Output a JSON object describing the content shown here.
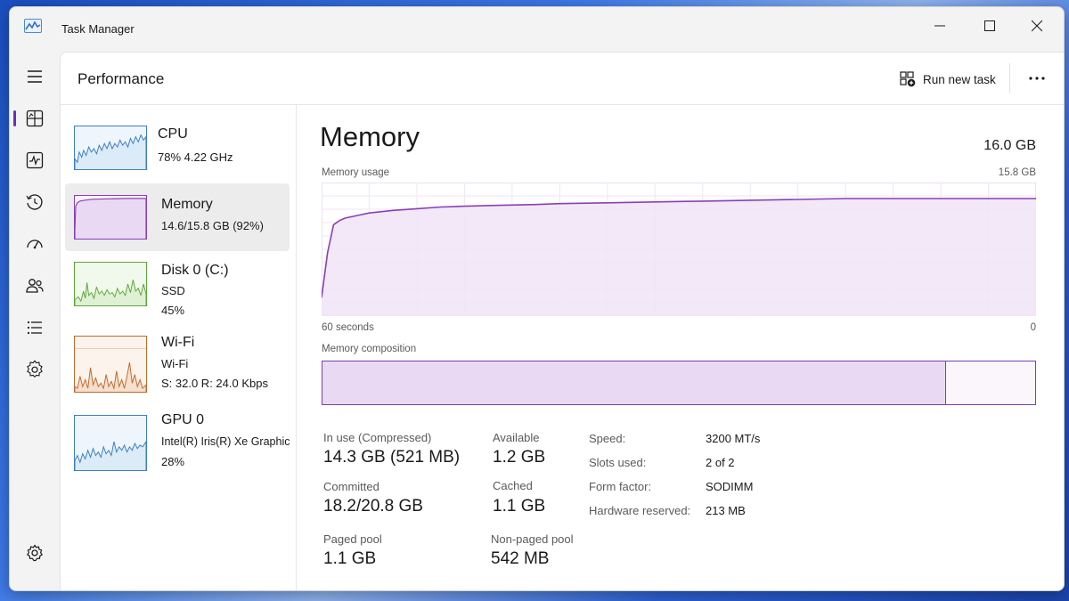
{
  "window": {
    "title": "Task Manager"
  },
  "header": {
    "page_title": "Performance",
    "run_new_task_label": "Run new task",
    "more_label": "···"
  },
  "colors": {
    "accent": "#6a2fb8",
    "memory_line": "#8b3fb5",
    "memory_fill": "#f1e6f7",
    "cpu_line": "#3b7fc1",
    "disk_line": "#5da83a",
    "wifi_line": "#c06a2e",
    "gpu_line": "#3b7fc1"
  },
  "nav": {
    "icons": [
      "hamburger-icon",
      "performance-icon",
      "app-history-icon",
      "startup-apps-icon",
      "users-icon",
      "details-icon",
      "services-icon",
      "settings-icon"
    ]
  },
  "sidebar": {
    "cpu": {
      "name": "CPU",
      "detail": "78%  4.22 GHz"
    },
    "memory": {
      "name": "Memory",
      "detail": "14.6/15.8 GB (92%)"
    },
    "disk": {
      "name": "Disk 0 (C:)",
      "detail1": "SSD",
      "detail2": "45%"
    },
    "wifi": {
      "name": "Wi-Fi",
      "detail1": "Wi-Fi",
      "detail2": "S: 32.0  R: 24.0 Kbps"
    },
    "gpu": {
      "name": "GPU 0",
      "detail1": "Intel(R) Iris(R) Xe Graphics",
      "detail2": "28%"
    }
  },
  "detail": {
    "title": "Memory",
    "total": "16.0 GB",
    "usage_label": "Memory usage",
    "usage_max": "15.8 GB",
    "time_left": "60 seconds",
    "time_right": "0",
    "composition_label": "Memory composition",
    "composition_in_use_fraction": 0.875,
    "stats": {
      "in_use_label": "In use (Compressed)",
      "in_use_value": "14.3 GB (521 MB)",
      "available_label": "Available",
      "available_value": "1.2 GB",
      "committed_label": "Committed",
      "committed_value": "18.2/20.8 GB",
      "cached_label": "Cached",
      "cached_value": "1.1 GB",
      "paged_label": "Paged pool",
      "paged_value": "1.1 GB",
      "nonpaged_label": "Non-paged pool",
      "nonpaged_value": "542 MB"
    },
    "specs": {
      "speed_label": "Speed:",
      "speed_value": "3200 MT/s",
      "slots_label": "Slots used:",
      "slots_value": "2 of 2",
      "form_label": "Form factor:",
      "form_value": "SODIMM",
      "reserved_label": "Hardware reserved:",
      "reserved_value": "213 MB"
    }
  },
  "chart_data": {
    "type": "area",
    "title": "Memory usage",
    "xlabel": "",
    "ylabel": "",
    "x_range_seconds": [
      60,
      0
    ],
    "ylim": [
      0,
      15.8
    ],
    "x": [
      60,
      59.5,
      59,
      58.5,
      58,
      57,
      56,
      54,
      52,
      50,
      48,
      45,
      42,
      40,
      36,
      32,
      28,
      24,
      20,
      16,
      12,
      8,
      4,
      2,
      1,
      0
    ],
    "values": [
      2.2,
      7.5,
      10.8,
      11.3,
      11.6,
      11.9,
      12.2,
      12.5,
      12.7,
      12.9,
      13.0,
      13.1,
      13.2,
      13.3,
      13.4,
      13.5,
      13.6,
      13.7,
      13.8,
      13.9,
      13.9,
      13.9,
      13.9,
      13.9,
      13.9,
      13.9
    ]
  }
}
